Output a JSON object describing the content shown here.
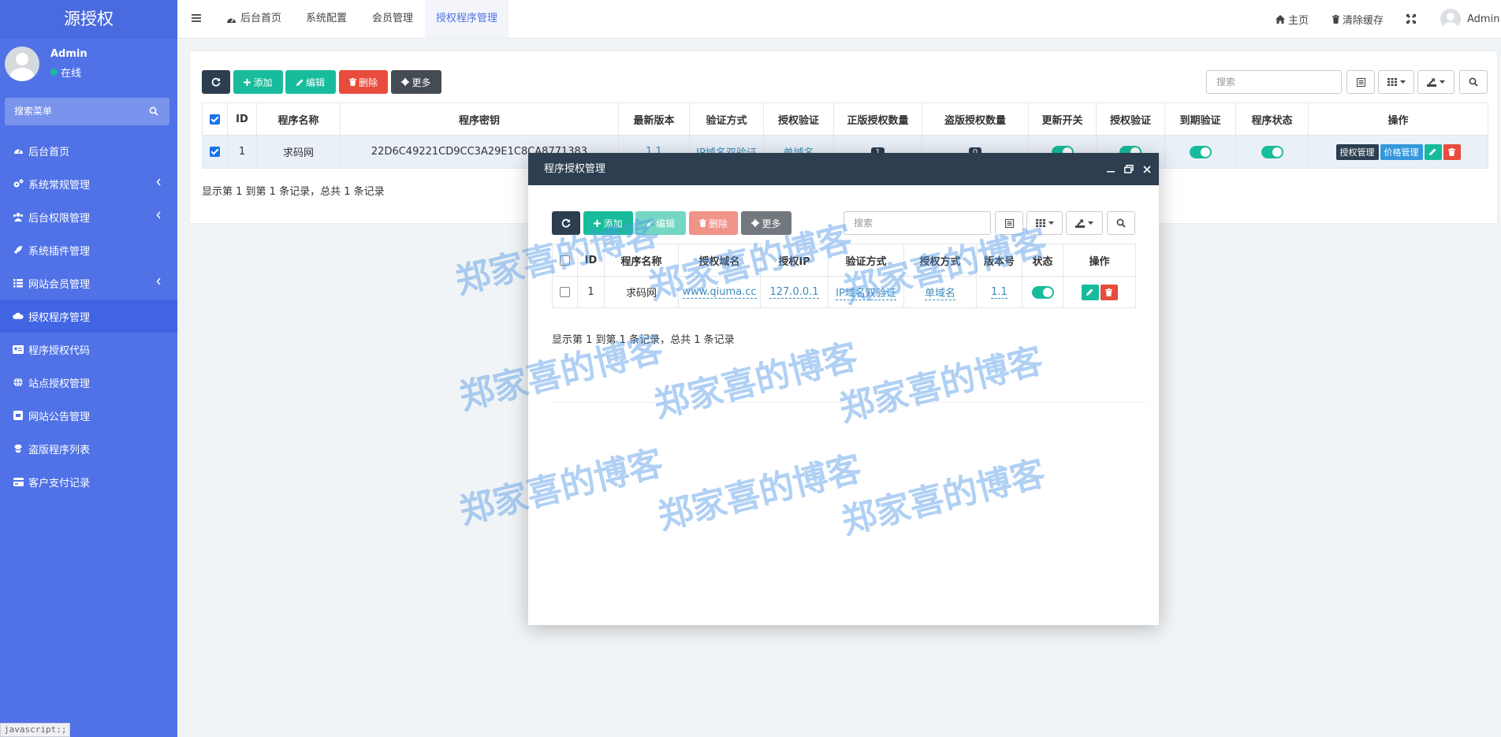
{
  "sidebar": {
    "logo": "源授权",
    "user_name": "Admin",
    "user_status": "在线",
    "search_placeholder": "搜索菜单",
    "items": [
      {
        "label": "后台首页"
      },
      {
        "label": "系统常规管理"
      },
      {
        "label": "后台权限管理"
      },
      {
        "label": "系统插件管理"
      },
      {
        "label": "网站会员管理"
      },
      {
        "label": "授权程序管理"
      },
      {
        "label": "程序授权代码"
      },
      {
        "label": "站点授权管理"
      },
      {
        "label": "网站公告管理"
      },
      {
        "label": "盗版程序列表"
      },
      {
        "label": "客户支付记录"
      }
    ]
  },
  "status_bar": "javascript:;",
  "topnav": {
    "tabs": [
      "后台首页",
      "系统配置",
      "会员管理",
      "授权程序管理"
    ],
    "home": "主页",
    "clear_cache": "清除缓存",
    "admin": "Admin"
  },
  "toolbar": {
    "add": "添加",
    "edit": "编辑",
    "delete": "删除",
    "more": "更多",
    "search_placeholder": "搜索"
  },
  "main_table": {
    "headers": [
      "ID",
      "程序名称",
      "程序密钥",
      "最新版本",
      "验证方式",
      "授权验证",
      "正版授权数量",
      "盗版授权数量",
      "更新开关",
      "授权验证",
      "到期验证",
      "程序状态",
      "操作"
    ],
    "row": {
      "id": "1",
      "name": "求码网",
      "key": "22D6C49221CD9CC3A29E1C8CA8771383",
      "version": "1.1",
      "verify_method": "IP域名双验证",
      "auth_verify": "单域名",
      "genuine_count": "1",
      "pirate_count": "0",
      "btn_auth": "授权管理",
      "btn_price": "价格管理"
    },
    "summary": "显示第 1 到第 1 条记录，总共 1 条记录"
  },
  "modal": {
    "title": "程序授权管理",
    "toolbar": {
      "add": "添加",
      "edit": "编辑",
      "delete": "删除",
      "more": "更多",
      "search_placeholder": "搜索"
    },
    "table": {
      "headers": [
        "ID",
        "程序名称",
        "授权域名",
        "授权IP",
        "验证方式",
        "授权方式",
        "版本号",
        "状态",
        "操作"
      ],
      "row": {
        "id": "1",
        "name": "求码网",
        "domain": "www.qiuma.cc",
        "ip": "127.0.0.1",
        "verify": "IP域名双验证",
        "auth_type": "单域名",
        "version": "1.1"
      }
    },
    "summary": "显示第 1 到第 1 条记录，总共 1 条记录"
  },
  "watermark": "郑家喜的博客",
  "colors": {
    "sidebar": "#5072e6",
    "dark": "#2c3e50",
    "green": "#18bc9c",
    "red": "#e74c3c",
    "link": "#3c8dbc"
  }
}
